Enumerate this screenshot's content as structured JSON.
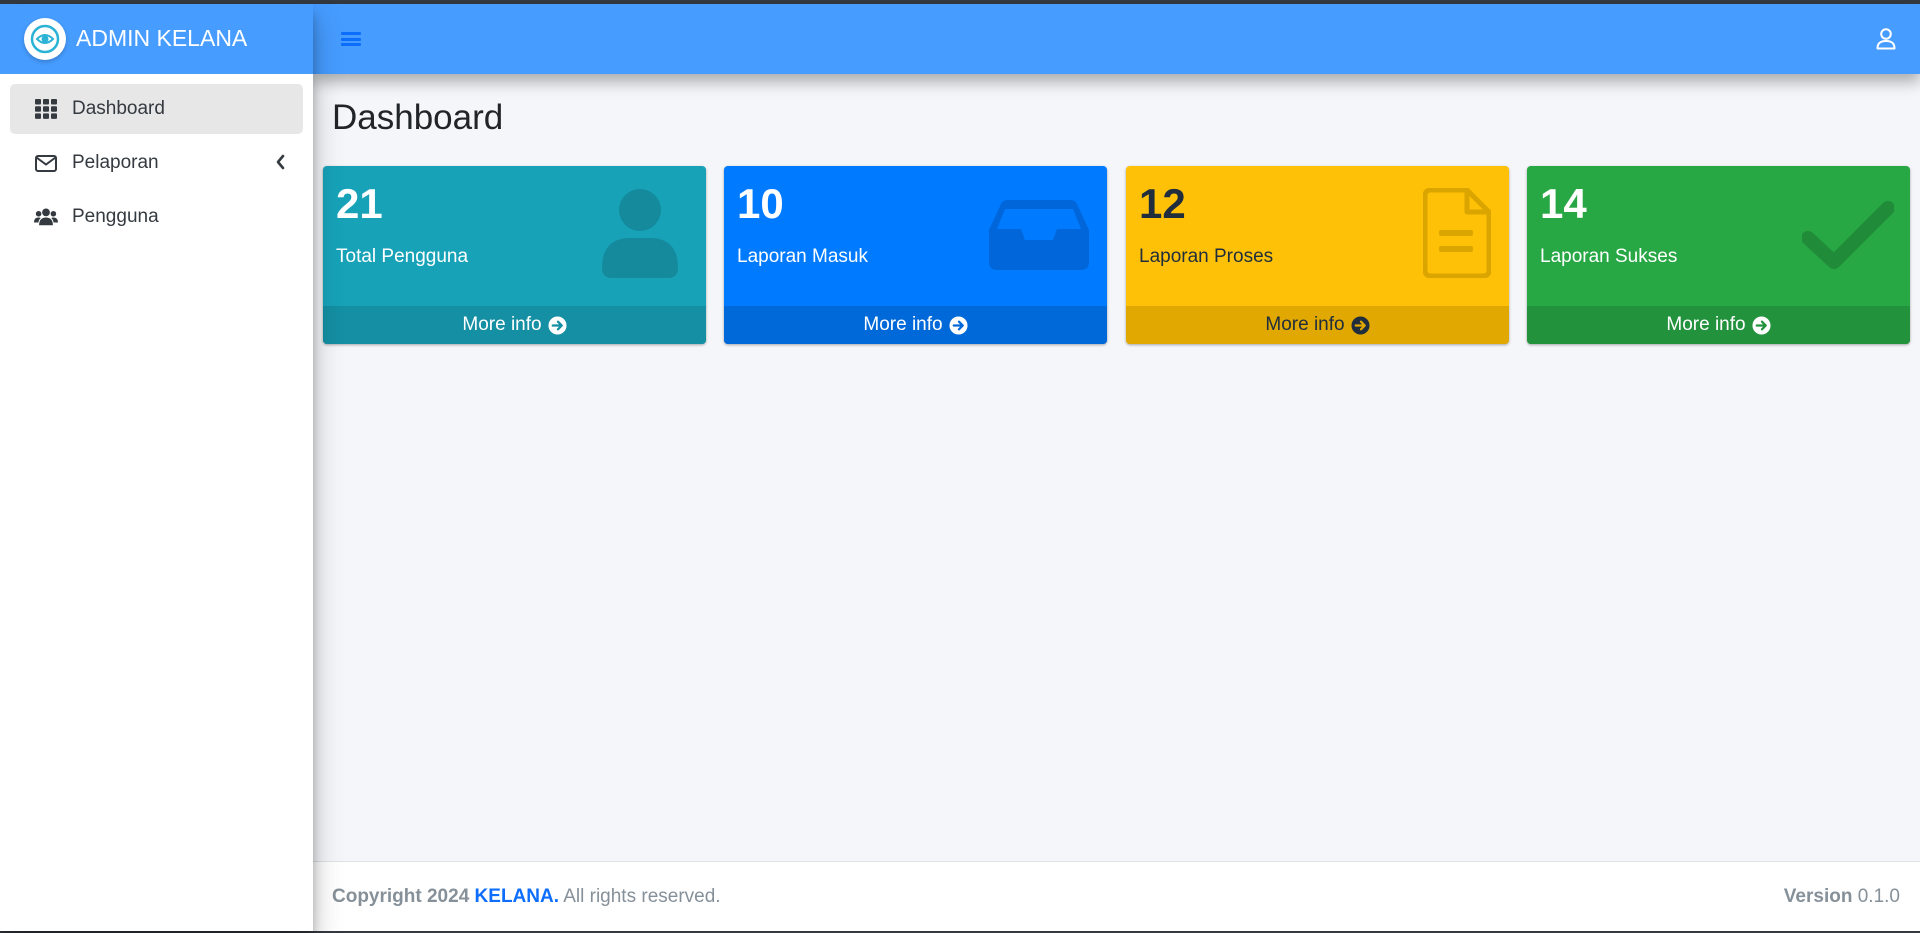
{
  "brand": {
    "name": "ADMIN KELANA"
  },
  "sidebar": {
    "items": [
      {
        "label": "Dashboard",
        "icon": "grid-icon"
      },
      {
        "label": "Pelaporan",
        "icon": "envelope-icon"
      },
      {
        "label": "Pengguna",
        "icon": "users-icon"
      }
    ]
  },
  "header": {
    "menu_icon": "hamburger-icon",
    "user_icon": "user-icon"
  },
  "main": {
    "title": "Dashboard",
    "cards": [
      {
        "value": "21",
        "label": "Total Pengguna",
        "footer": "More info",
        "color": "#17a2b8",
        "icon": "user-icon"
      },
      {
        "value": "10",
        "label": "Laporan Masuk",
        "footer": "More info",
        "color": "#007bff",
        "icon": "inbox-icon"
      },
      {
        "value": "12",
        "label": "Laporan Proses",
        "footer": "More info",
        "color": "#ffc107",
        "icon": "file-icon"
      },
      {
        "value": "14",
        "label": "Laporan Sukses",
        "footer": "More info",
        "color": "#28a745",
        "icon": "check-icon"
      }
    ]
  },
  "footer": {
    "copyright": "Copyright 2024",
    "brand": "KELANA.",
    "rights": "All rights reserved.",
    "version_label": "Version",
    "version": "0.1.0"
  }
}
